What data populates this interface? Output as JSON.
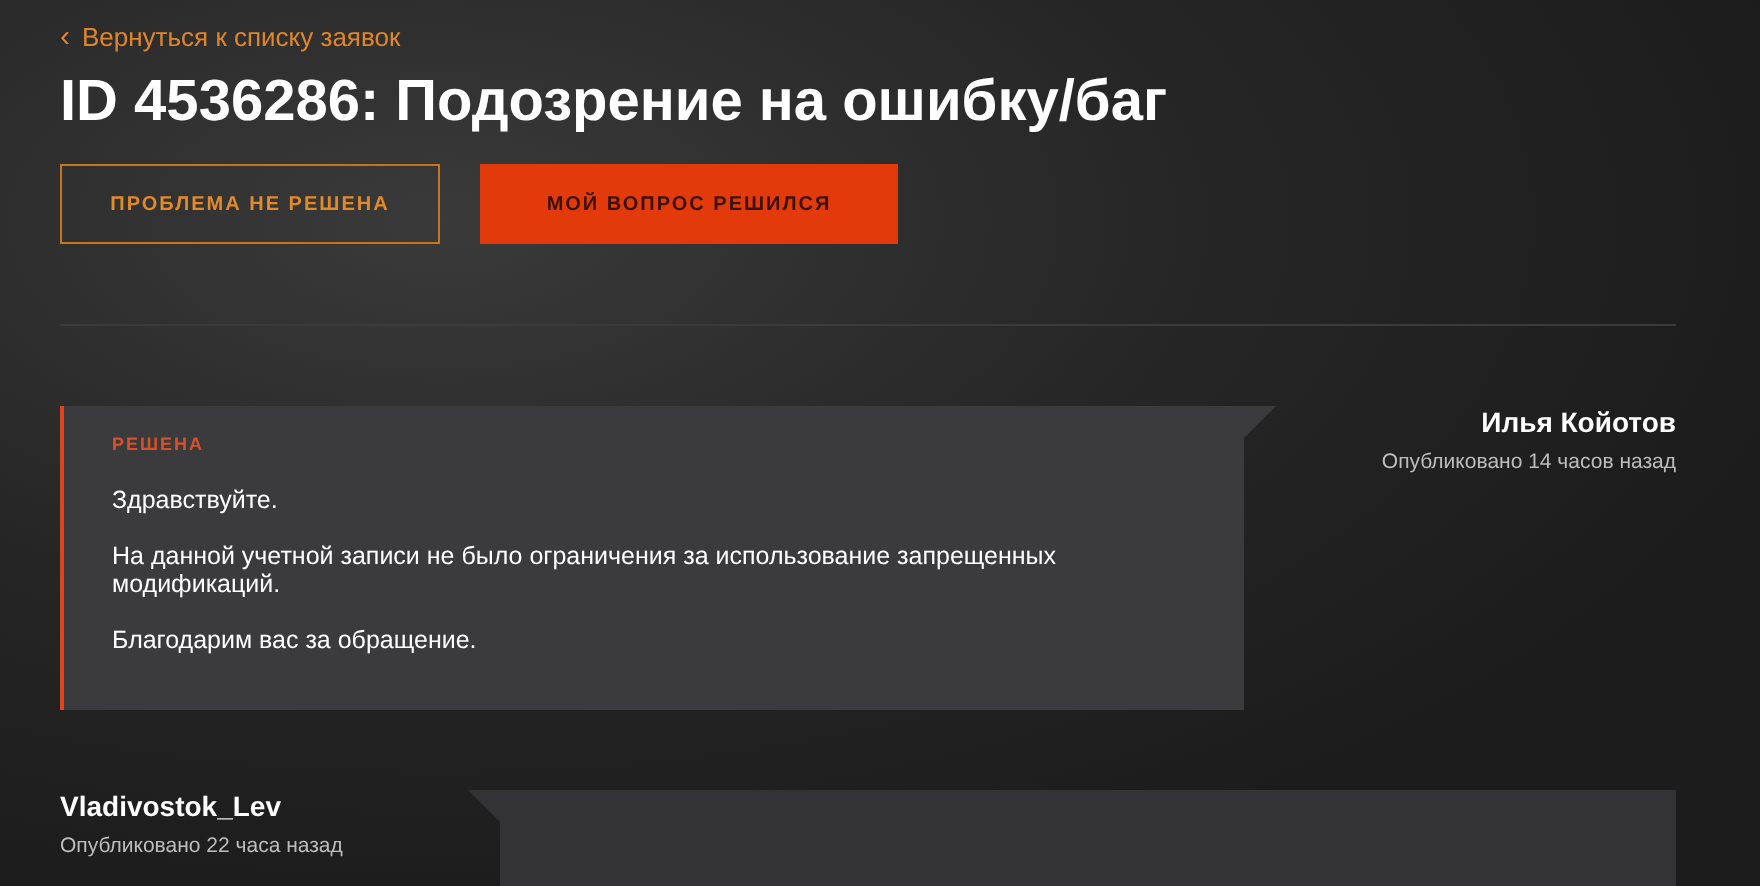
{
  "back_link": {
    "icon": "‹",
    "label": "Вернуться к списку заявок"
  },
  "title": "ID 4536286: Подозрение на ошибку/баг",
  "buttons": [
    {
      "label": "ПРОБЛЕМА НЕ РЕШЕНА",
      "kind": "outline"
    },
    {
      "label": "МОЙ ВОПРОС РЕШИЛСЯ",
      "kind": "primary"
    }
  ],
  "messages": [
    {
      "kind": "staff",
      "author": "Илья Койотов",
      "published": "Опубликовано 14 часов назад",
      "status": "РЕШЕНА",
      "paragraphs": [
        "Здравствуйте.",
        "На данной учетной записи не было ограничения за использование  запрещенных модификаций.",
        "Благодарим вас за обращение."
      ]
    },
    {
      "kind": "user",
      "author": "Vladivostok_Lev",
      "published": "Опубликовано 22 часа назад"
    }
  ]
}
